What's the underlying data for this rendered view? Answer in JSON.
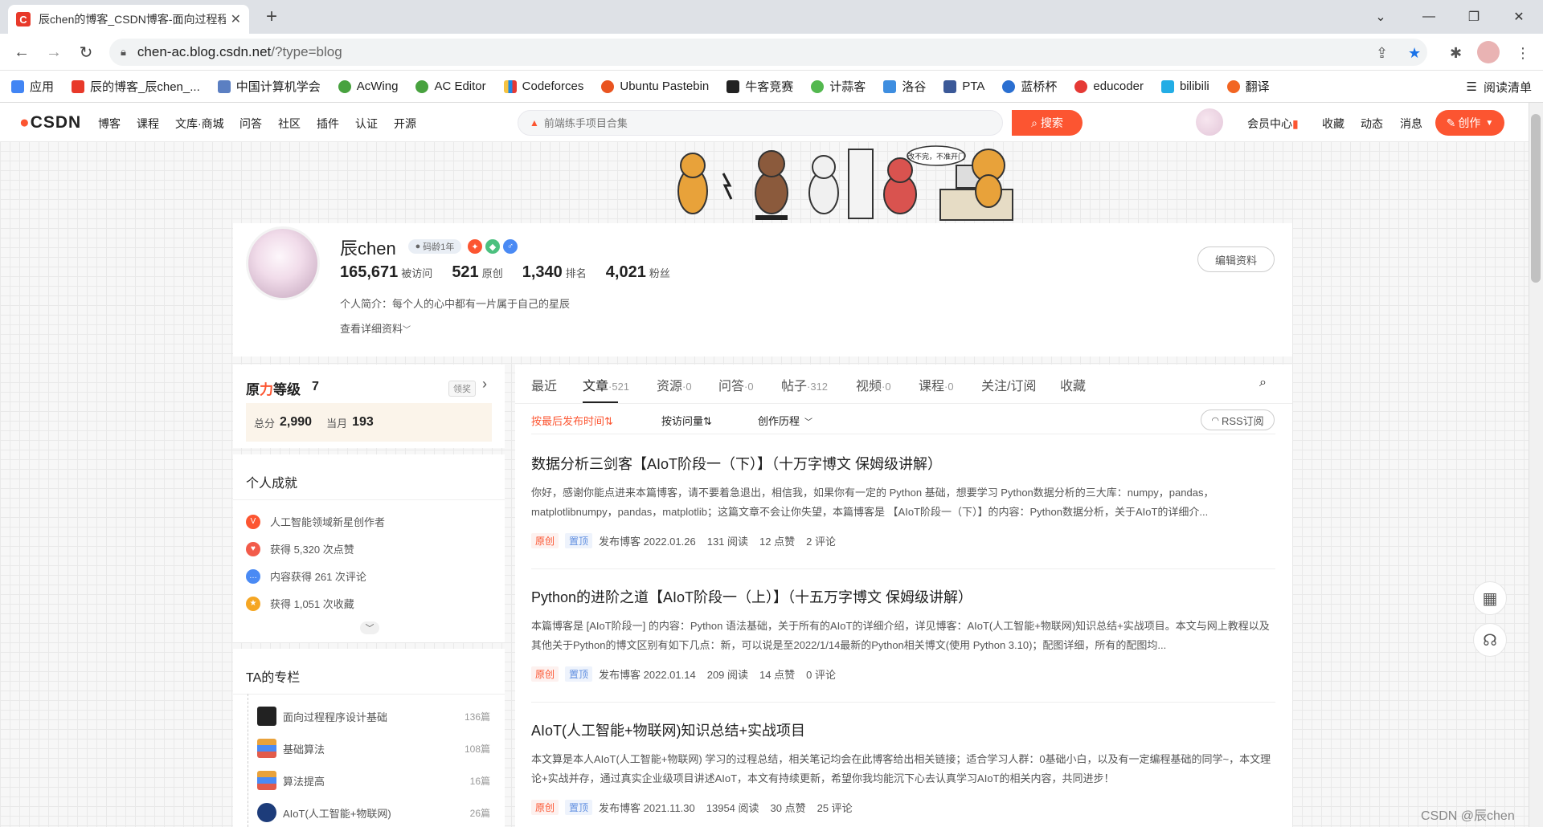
{
  "browser": {
    "tab_title": "辰chen的博客_CSDN博客-面向过程程序设计基础,基础算法,算法提高领域博主",
    "tab_favicon": "C",
    "url_host": "chen-ac.blog.csdn.net",
    "url_path": "/?type=blog",
    "bookmarks": [
      {
        "label": "应用",
        "color": "#4285f4"
      },
      {
        "label": "辰的博客_辰chen_...",
        "color": "#e8392a"
      },
      {
        "label": "中国计算机学会",
        "color": "#5b7fc2"
      },
      {
        "label": "AcWing",
        "color": "#48a23f"
      },
      {
        "label": "AC Editor",
        "color": "#48a23f"
      },
      {
        "label": "Codeforces",
        "color": "#1e88e5"
      },
      {
        "label": "Ubuntu Pastebin",
        "color": "#e95420"
      },
      {
        "label": "牛客竞赛",
        "color": "#222222"
      },
      {
        "label": "计蒜客",
        "color": "#53b84f"
      },
      {
        "label": "洛谷",
        "color": "#3e8ee0"
      },
      {
        "label": "PTA",
        "color": "#3b5998"
      },
      {
        "label": "蓝桥杯",
        "color": "#2a6fd1"
      },
      {
        "label": "educoder",
        "color": "#e53935"
      },
      {
        "label": "bilibili",
        "color": "#23ade5"
      },
      {
        "label": "翻译",
        "color": "#f26522"
      }
    ],
    "reading_list": "阅读清单"
  },
  "csdn": {
    "logo": "CSDN",
    "nav": [
      "博客",
      "课程",
      "文库·商城",
      "问答",
      "社区",
      "插件",
      "认证",
      "开源"
    ],
    "search_placeholder": "前端练手项目合集",
    "search_button": "搜索",
    "right_links": [
      "会员中心",
      "收藏",
      "动态",
      "消息"
    ],
    "create_button": "创作"
  },
  "banner": {
    "speech": "改不完，不准开门"
  },
  "profile": {
    "name": "辰chen",
    "code_age": "码龄1年",
    "stats": [
      {
        "value": "165,671",
        "label": "被访问"
      },
      {
        "value": "521",
        "label": "原创"
      },
      {
        "value": "1,340",
        "label": "排名"
      },
      {
        "value": "4,021",
        "label": "粉丝"
      }
    ],
    "intro": "个人简介：每个人的心中都有一片属于自己的星辰",
    "detail_link": "查看详细资料",
    "edit_button": "编辑资料"
  },
  "level": {
    "title_a": "原",
    "title_b": "力",
    "title_c": "等级",
    "level": "7",
    "link": "领奖",
    "total_label": "总分",
    "total": "2,990",
    "month_label": "当月",
    "month": "193"
  },
  "achievements": {
    "title": "个人成就",
    "items": [
      {
        "text": "人工智能领域新星创作者",
        "color": "#fc5531",
        "glyph": "V"
      },
      {
        "text": "获得 5,320 次点赞",
        "color": "#f25b4a",
        "glyph": "♥"
      },
      {
        "text": "内容获得 261 次评论",
        "color": "#4a8af4",
        "glyph": "…"
      },
      {
        "text": "获得 1,051 次收藏",
        "color": "#f5a623",
        "glyph": "★"
      }
    ]
  },
  "columns": {
    "title": "TA的专栏",
    "items": [
      {
        "name": "面向过程程序设计基础",
        "count": "136篇",
        "color": "#222222"
      },
      {
        "name": "基础算法",
        "count": "108篇",
        "color": "#e9a23b"
      },
      {
        "name": "算法提高",
        "count": "16篇",
        "color": "#e9a23b"
      },
      {
        "name": "AIoT(人工智能+物联网)",
        "count": "26篇",
        "color": "#1d3c7a"
      }
    ]
  },
  "tabs": [
    {
      "label": "最近",
      "count": ""
    },
    {
      "label": "文章",
      "count": "·521"
    },
    {
      "label": "资源",
      "count": "·0"
    },
    {
      "label": "问答",
      "count": "·0"
    },
    {
      "label": "帖子",
      "count": "·312"
    },
    {
      "label": "视频",
      "count": "·0"
    },
    {
      "label": "课程",
      "count": "·0"
    },
    {
      "label": "关注/订阅",
      "count": ""
    },
    {
      "label": "收藏",
      "count": ""
    }
  ],
  "sort": {
    "by_time": "按最后发布时间⇅",
    "by_views": "按访问量⇅",
    "history": "创作历程",
    "rss": "RSS订阅"
  },
  "articles": [
    {
      "title": "数据分析三剑客【AIoT阶段一（下）】（十万字博文 保姆级讲解）",
      "desc": "你好，感谢你能点进来本篇博客，请不要着急退出，相信我，如果你有一定的 Python 基础，想要学习 Python数据分析的三大库：numpy，pandas，matplotlibnumpy，pandas，matplotlib；这篇文章不会让你失望，本篇博客是 【AIoT阶段一（下）】的内容：Python数据分析，关于AIoT的详细介...",
      "tag1": "原创",
      "tag2": "置顶",
      "date": "发布博客 2022.01.26",
      "reads": "131 阅读",
      "likes": "12 点赞",
      "comments": "2 评论"
    },
    {
      "title": "Python的进阶之道【AIoT阶段一（上）】（十五万字博文 保姆级讲解）",
      "desc": "本篇博客是 [AIoT阶段一] 的内容：Python 语法基础，关于所有的AIoT的详细介绍，详见博客：AIoT(人工智能+物联网)知识总结+实战项目。本文与网上教程以及其他关于Python的博文区别有如下几点：新，可以说是至2022/1/14最新的Python相关博文(使用 Python 3.10)；配图详细，所有的配图均...",
      "tag1": "原创",
      "tag2": "置顶",
      "date": "发布博客 2022.01.14",
      "reads": "209 阅读",
      "likes": "14 点赞",
      "comments": "0 评论"
    },
    {
      "title": "AIoT(人工智能+物联网)知识总结+实战项目",
      "desc": "本文算是本人AIoT(人工智能+物联网) 学习的过程总结，相关笔记均会在此博客给出相关链接；适合学习人群：0基础小白，以及有一定编程基础的同学~，本文理论+实战并存，通过真实企业级项目讲述AIoT，本文有持续更新，希望你我均能沉下心去认真学习AIoT的相关内容，共同进步！",
      "tag1": "原创",
      "tag2": "置顶",
      "date": "发布博客 2021.11.30",
      "reads": "13954 阅读",
      "likes": "30 点赞",
      "comments": "25 评论"
    }
  ],
  "watermark": "CSDN @辰chen"
}
